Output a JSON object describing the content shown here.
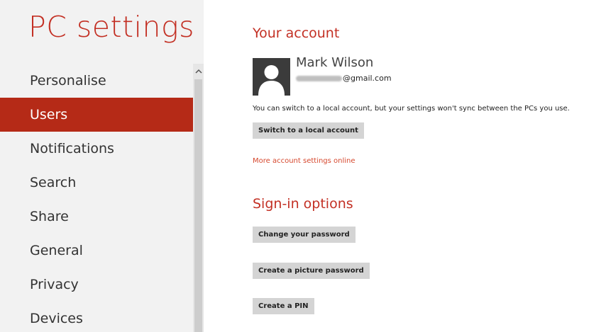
{
  "app": {
    "title": "PC settings"
  },
  "nav": {
    "items": [
      {
        "label": "Personalise"
      },
      {
        "label": "Users"
      },
      {
        "label": "Notifications"
      },
      {
        "label": "Search"
      },
      {
        "label": "Share"
      },
      {
        "label": "General"
      },
      {
        "label": "Privacy"
      },
      {
        "label": "Devices"
      }
    ],
    "selected": "Users",
    "scroll_up_icon": "chevron-up-icon"
  },
  "account": {
    "heading": "Your account",
    "user_name": "Mark Wilson",
    "email_domain": "@gmail.com",
    "avatar_icon": "user-silhouette-icon",
    "info_text": "You can switch to a local account, but your settings won't sync between the PCs you use.",
    "switch_button": "Switch to a local account",
    "more_link": "More account settings online"
  },
  "signin": {
    "heading": "Sign-in options",
    "change_password_button": "Change your password",
    "picture_password_button": "Create a picture password",
    "pin_button": "Create a PIN"
  },
  "colors": {
    "accent": "#c33024",
    "selected_bg": "#b52a17",
    "left_pane_bg": "#f2f2f2",
    "button_bg": "#d4d4d4"
  }
}
